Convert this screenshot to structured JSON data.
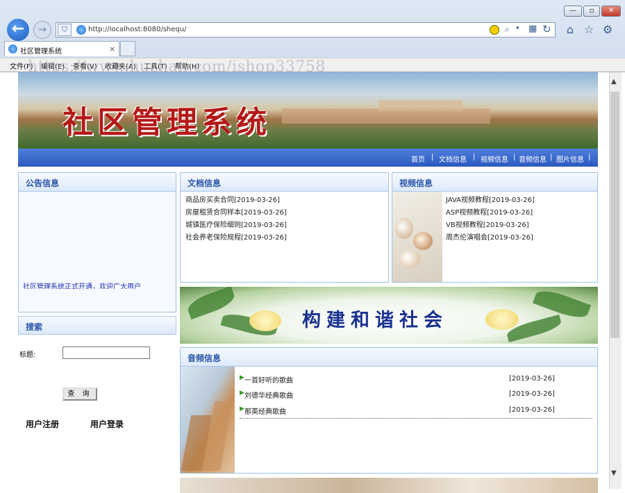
{
  "browser": {
    "url": "http://localhost:8080/shequ/",
    "tab_title": "社区管理系统",
    "tab_close": "×",
    "menus": [
      "文件(F)",
      "编辑(E)",
      "查看(V)",
      "收藏夹(A)",
      "工具(T)",
      "帮助(H)"
    ],
    "watermark": "https://www.huzhan.com/ishop33758"
  },
  "site": {
    "banner_title": "社区管理系统",
    "nav": [
      "首页",
      "文档信息",
      "视频信息",
      "音频信息",
      "图片信息"
    ]
  },
  "notice": {
    "heading": "公告信息",
    "text": "社区管理系统正式开通，欢迎广大用户"
  },
  "documents": {
    "heading": "文档信息",
    "items": [
      "商品房买卖合同[2019-03-26]",
      "房屋租赁合同样本[2019-03-26]",
      "城镇医疗保险细则[2019-03-26]",
      "社会养老保险规程[2019-03-26]"
    ]
  },
  "videos": {
    "heading": "视频信息",
    "items": [
      "JAVA视频教程[2019-03-26]",
      "ASP视频教程[2019-03-26]",
      "VB视频教程[2019-03-26]",
      "周杰伦演唱会[2019-03-26]"
    ]
  },
  "search": {
    "heading": "搜索",
    "label": "标题:",
    "button": "查 询"
  },
  "user_links": [
    "用户注册",
    "用户登录"
  ],
  "slogan": "构建和谐社会",
  "audio": {
    "heading": "音频信息",
    "items": [
      {
        "title": "一首好听的歌曲",
        "date": "[2019-03-26]"
      },
      {
        "title": "刘德华经典歌曲",
        "date": "[2019-03-26]"
      },
      {
        "title": "那英经典歌曲",
        "date": "[2019-03-26]"
      }
    ]
  }
}
